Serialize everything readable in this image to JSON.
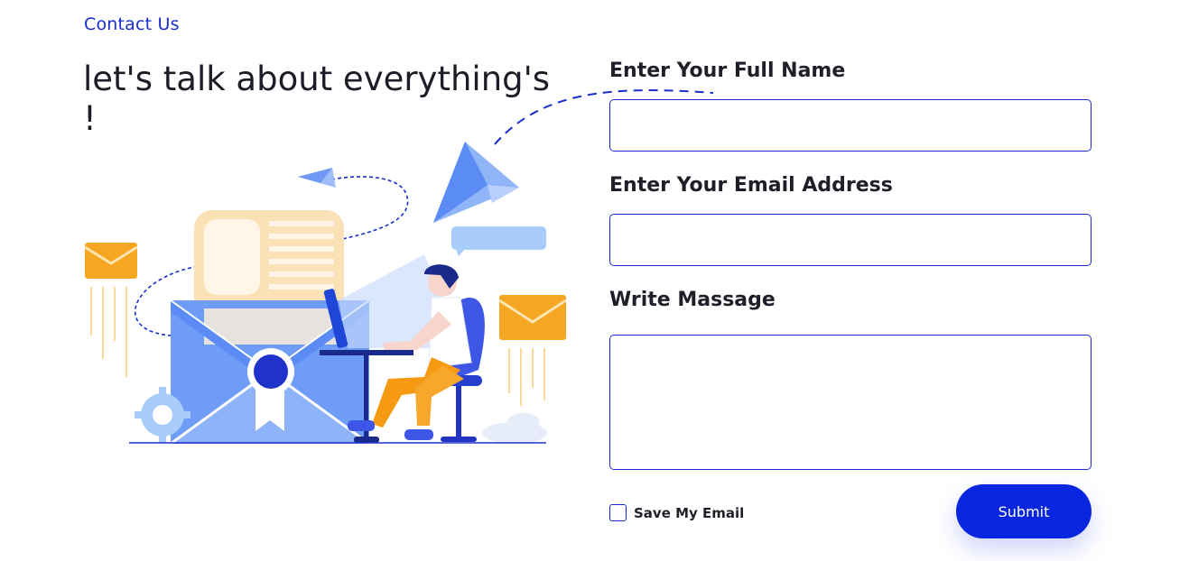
{
  "header": {
    "kicker": "Contact Us",
    "headline_line1": "let's talk about everything's",
    "headline_line2": "!"
  },
  "form": {
    "name_label": "Enter Your Full Name",
    "name_value": "",
    "email_label": "Enter Your Email Address",
    "email_value": "",
    "message_label": "Write Massage",
    "message_value": "",
    "save_label": "Save My Email",
    "save_checked": false,
    "submit_label": "Submit"
  },
  "colors": {
    "accent": "#0826e0",
    "link": "#1a2ecc",
    "envelope_orange": "#f5a623",
    "illustration_blue": "#5b8cf5"
  }
}
